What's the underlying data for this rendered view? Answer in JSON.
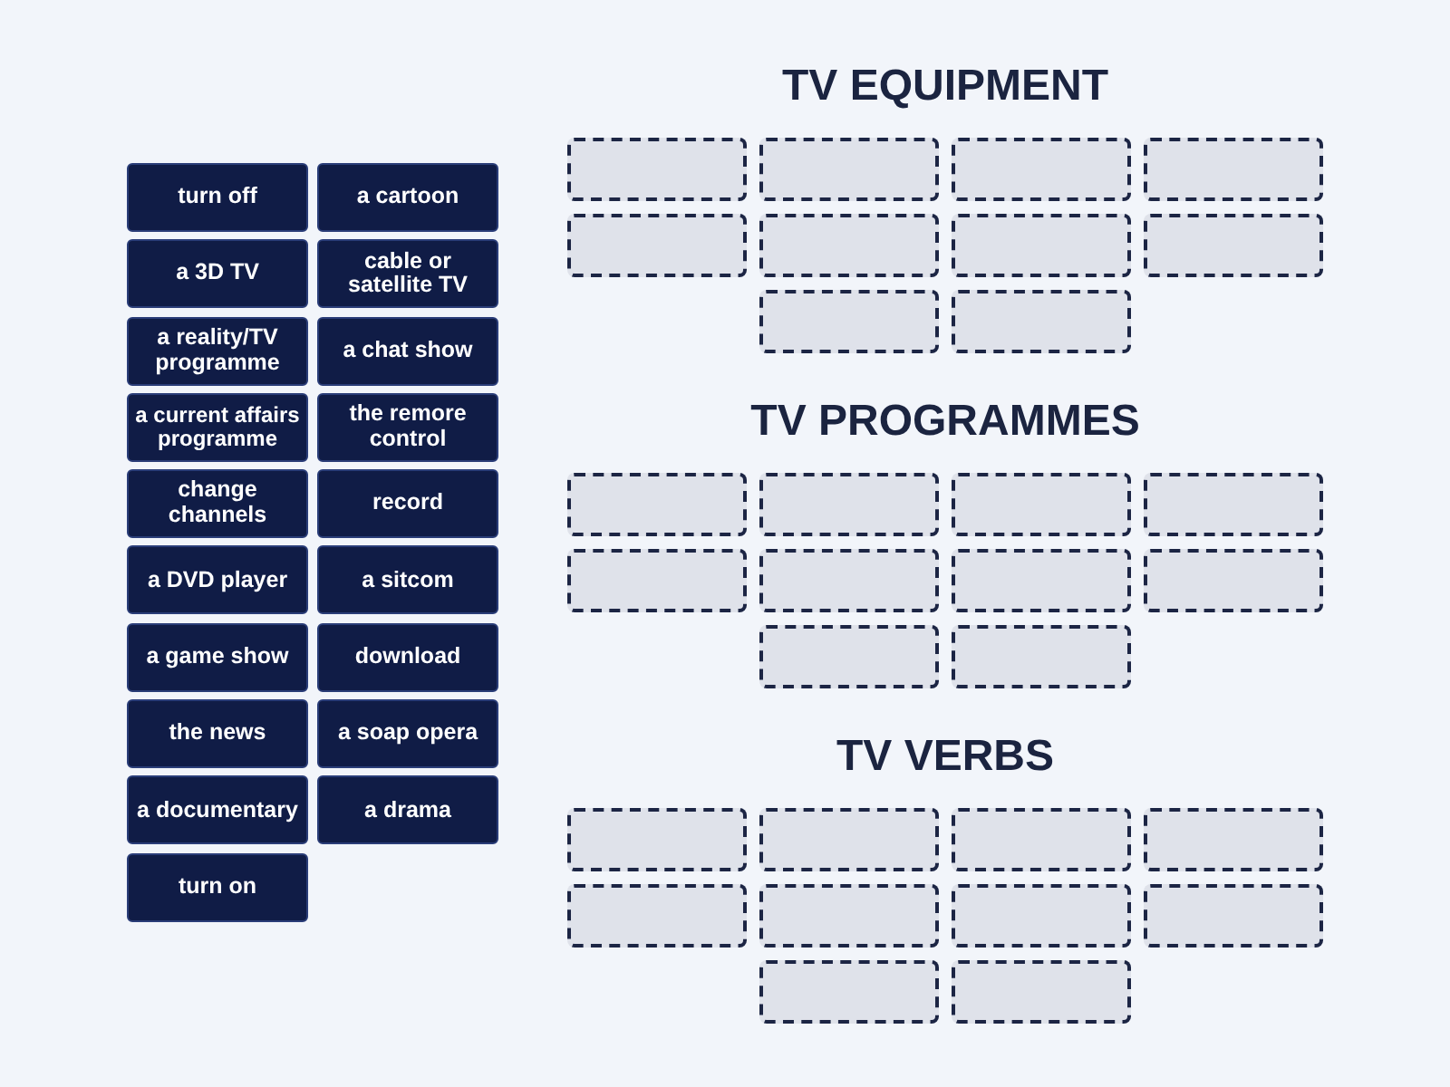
{
  "cards": [
    "turn off",
    "a cartoon",
    "a 3D TV",
    "cable or satellite TV",
    "a reality/TV programme",
    "a chat show",
    "a current affairs programme",
    "the remore control",
    "change channels",
    "record",
    "a DVD player",
    "a sitcom",
    "a game show",
    "download",
    "the news",
    "a soap opera",
    "a documentary",
    "a drama",
    "turn on"
  ],
  "groups": [
    {
      "title": "TV EQUIPMENT",
      "slots": [
        {
          "kind": "empty"
        },
        {
          "kind": "empty"
        },
        {
          "kind": "empty"
        },
        {
          "kind": "empty"
        },
        {
          "kind": "empty"
        },
        {
          "kind": "empty"
        },
        {
          "kind": "empty"
        },
        {
          "kind": "empty"
        },
        {
          "kind": "empty"
        },
        {
          "kind": "empty"
        }
      ]
    },
    {
      "title": "TV PROGRAMMES",
      "slots": [
        {
          "kind": "empty"
        },
        {
          "kind": "empty"
        },
        {
          "kind": "empty"
        },
        {
          "kind": "empty"
        },
        {
          "kind": "empty"
        },
        {
          "kind": "empty"
        },
        {
          "kind": "empty"
        },
        {
          "kind": "empty"
        },
        {
          "kind": "empty"
        },
        {
          "kind": "empty"
        }
      ]
    },
    {
      "title": "TV VERBS",
      "slots": [
        {
          "kind": "empty"
        },
        {
          "kind": "empty"
        },
        {
          "kind": "empty"
        },
        {
          "kind": "empty"
        },
        {
          "kind": "empty"
        },
        {
          "kind": "empty"
        },
        {
          "kind": "empty"
        },
        {
          "kind": "empty"
        },
        {
          "kind": "empty"
        },
        {
          "kind": "empty"
        }
      ]
    }
  ]
}
